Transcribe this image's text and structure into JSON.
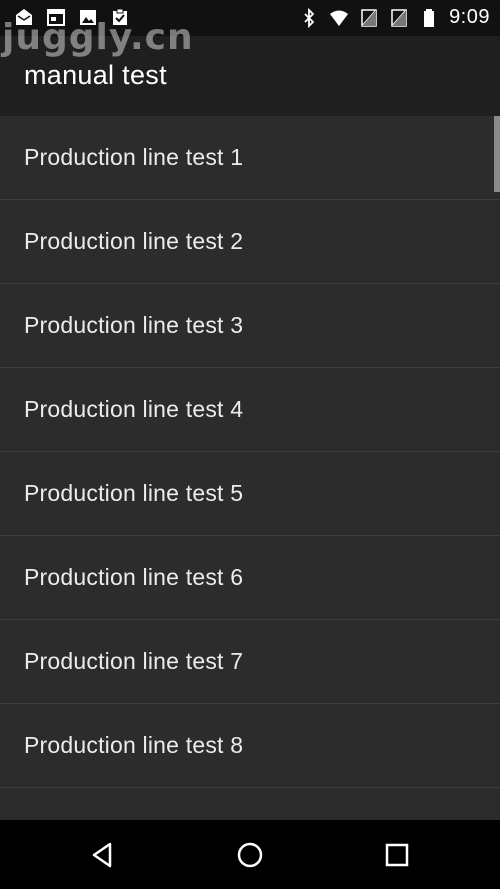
{
  "status_bar": {
    "time": "9:09",
    "left_icons": [
      "mail-icon",
      "calendar-icon",
      "image-icon",
      "clipboard-check-icon"
    ],
    "right_icons": [
      "bluetooth-icon",
      "wifi-icon",
      "no-sim-icon",
      "no-sim-icon",
      "battery-icon"
    ]
  },
  "watermark": "juggly.cn",
  "app_bar": {
    "title": "manual test"
  },
  "list": {
    "items": [
      {
        "label": "Production line test 1"
      },
      {
        "label": "Production line test 2"
      },
      {
        "label": "Production line test 3"
      },
      {
        "label": "Production line test 4"
      },
      {
        "label": "Production line test 5"
      },
      {
        "label": "Production line test 6"
      },
      {
        "label": "Production line test 7"
      },
      {
        "label": "Production line test 8"
      },
      {
        "label": ""
      }
    ]
  },
  "nav_bar": {
    "icons": [
      "back-icon",
      "home-icon",
      "recent-apps-icon"
    ]
  },
  "colors": {
    "background": "#2b2b2b",
    "app_bar": "#1f1f1f",
    "status_bar": "#111111",
    "nav_bar": "#000000",
    "text": "#ececec"
  }
}
